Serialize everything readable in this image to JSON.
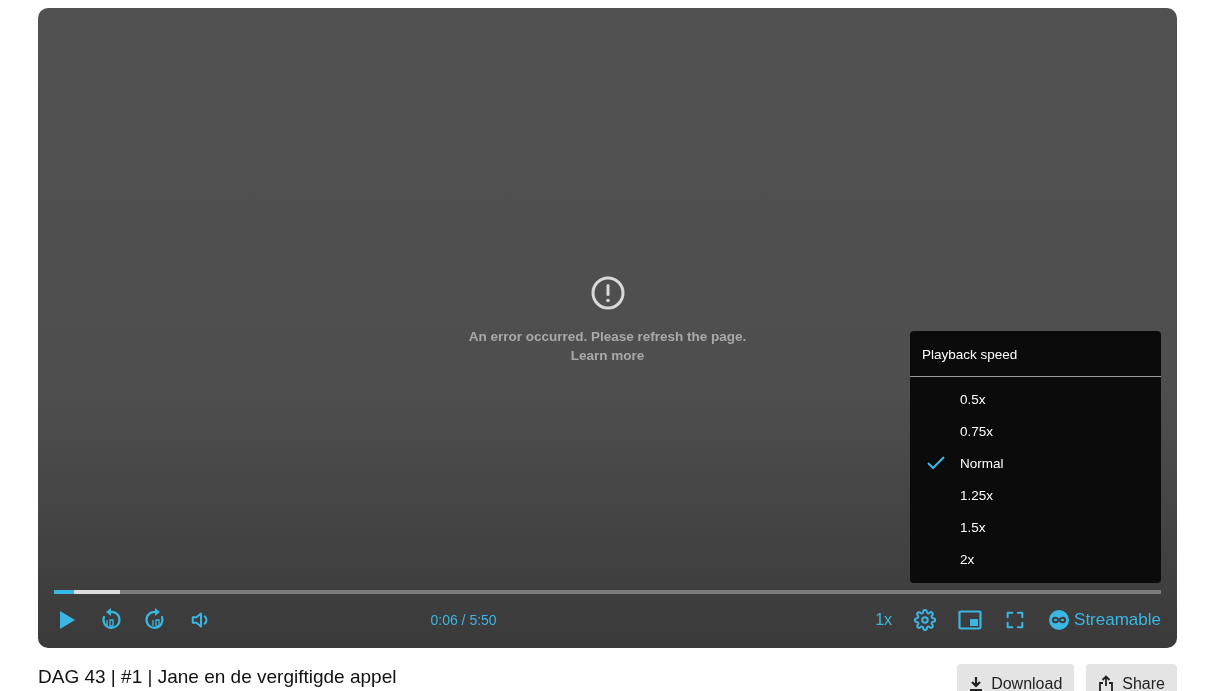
{
  "player": {
    "error": {
      "message": "An error occurred. Please refresh the page.",
      "link": "Learn more"
    },
    "progress": {
      "played": {
        "level": 0.018
      },
      "buffered": {
        "level": 0.06
      }
    },
    "time": "0:06 / 5:50",
    "speed_button": "1x",
    "brand": "Streamable",
    "speed_menu": {
      "title": "Playback speed",
      "options": [
        {
          "label": "0.5x",
          "selected": false
        },
        {
          "label": "0.75x",
          "selected": false
        },
        {
          "label": "Normal",
          "selected": true
        },
        {
          "label": "1.25x",
          "selected": false
        },
        {
          "label": "1.5x",
          "selected": false
        },
        {
          "label": "2x",
          "selected": false
        }
      ]
    }
  },
  "video_title": "DAG 43 | #1 | Jane en de vergiftigde appel",
  "actions": [
    {
      "label": "Download",
      "kind": "download"
    },
    {
      "label": "Share",
      "kind": "share"
    }
  ]
}
